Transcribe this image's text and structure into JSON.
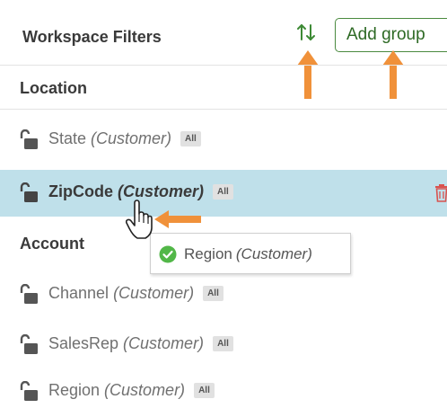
{
  "header": {
    "title": "Workspace Filters",
    "sort_icon": "sort-arrows-icon",
    "add_group_label": "Add group"
  },
  "colors": {
    "selected_row_bg": "#bfe0ea",
    "accent_green": "#4a8a3f",
    "annotation_orange": "#f0913a",
    "delete_red": "#d9534f",
    "badge_bg": "#e1e1e1"
  },
  "sections": [
    {
      "title": "Location",
      "items": [
        {
          "name": "State",
          "qualifier": "(Customer)",
          "badge": "All",
          "icon": "lock-icon"
        },
        {
          "name": "ZipCode",
          "qualifier": "(Customer)",
          "badge": "All",
          "icon": "lock-icon",
          "selected": true,
          "action_icon": "trash-icon"
        }
      ]
    },
    {
      "title": "Account",
      "items": [
        {
          "name": "Channel",
          "qualifier": "(Customer)",
          "badge": "All",
          "icon": "lock-icon"
        },
        {
          "name": "SalesRep",
          "qualifier": "(Customer)",
          "badge": "All",
          "icon": "lock-icon"
        },
        {
          "name": "Region",
          "qualifier": "(Customer)",
          "badge": "All",
          "icon": "lock-icon"
        }
      ]
    }
  ],
  "drag_tooltip": {
    "name": "Region",
    "qualifier": "(Customer)",
    "icon": "check-circle-icon"
  }
}
